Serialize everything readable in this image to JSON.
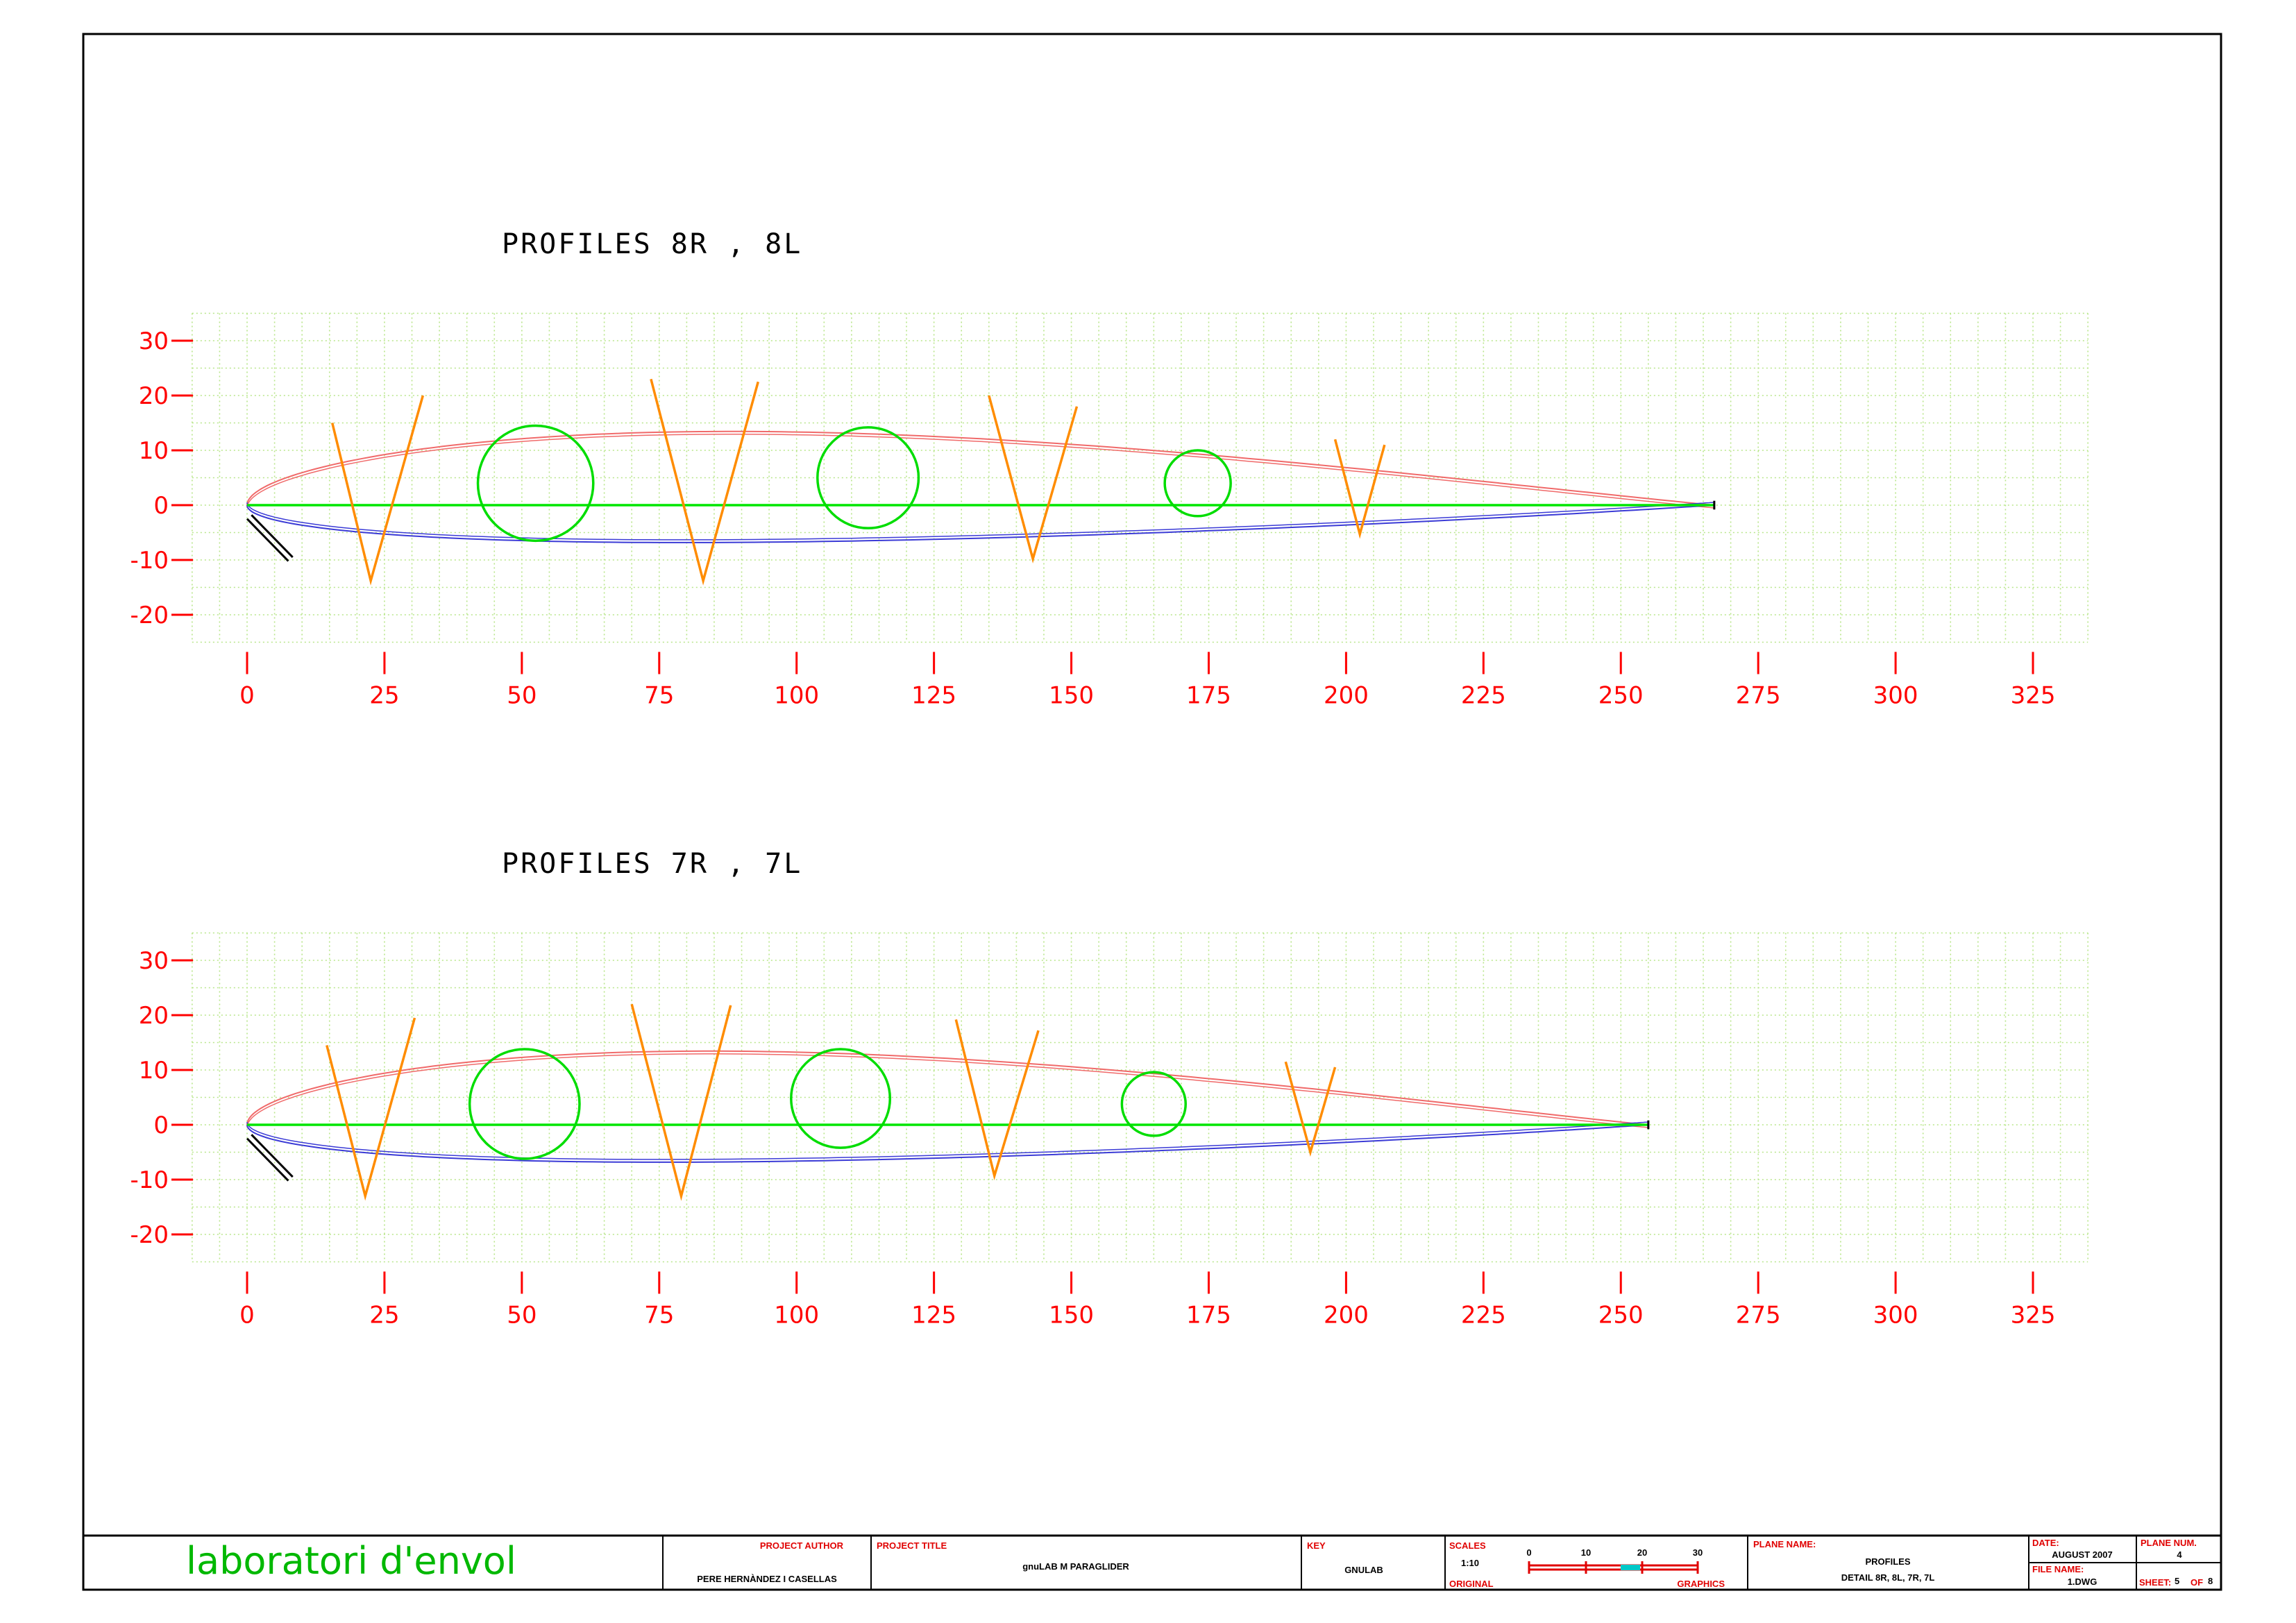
{
  "profiles": [
    {
      "title": "PROFILES 8R , 8L",
      "chord": 267,
      "circles": [
        {
          "x": 52.5,
          "y": 4,
          "r": 10.5
        },
        {
          "x": 113,
          "y": 5,
          "r": 9.2
        },
        {
          "x": 173,
          "y": 4,
          "r": 6
        }
      ],
      "diagonals": [
        {
          "x1": 15.5,
          "y1": 15,
          "x2": 22.5,
          "y2": -13.8,
          "x3": 32,
          "y3": 20
        },
        {
          "x1": 73.5,
          "y1": 23,
          "x2": 83,
          "y2": -13.8,
          "x3": 93,
          "y3": 22.5
        },
        {
          "x1": 135,
          "y1": 20,
          "x2": 143,
          "y2": -9.8,
          "x3": 151,
          "y3": 18
        },
        {
          "x1": 198,
          "y1": 12,
          "x2": 202.5,
          "y2": -5.3,
          "x3": 207,
          "y3": 11
        }
      ]
    },
    {
      "title": "PROFILES 7R , 7L",
      "chord": 255,
      "circles": [
        {
          "x": 50.5,
          "y": 3.8,
          "r": 10
        },
        {
          "x": 108,
          "y": 4.8,
          "r": 9
        },
        {
          "x": 165,
          "y": 3.8,
          "r": 5.8
        }
      ],
      "diagonals": [
        {
          "x1": 14.5,
          "y1": 14.5,
          "x2": 21.5,
          "y2": -13,
          "x3": 30.5,
          "y3": 19.5
        },
        {
          "x1": 70,
          "y1": 22,
          "x2": 79,
          "y2": -13,
          "x3": 88,
          "y3": 21.8
        },
        {
          "x1": 129,
          "y1": 19.2,
          "x2": 136,
          "y2": -9.3,
          "x3": 144,
          "y3": 17.2
        },
        {
          "x1": 189,
          "y1": 11.5,
          "x2": 193.5,
          "y2": -5,
          "x3": 198,
          "y3": 10.5
        }
      ]
    }
  ],
  "axes": {
    "x_ticks": [
      0,
      25,
      50,
      75,
      100,
      125,
      150,
      175,
      200,
      225,
      250,
      275,
      300,
      325
    ],
    "y_ticks": [
      30,
      20,
      10,
      0,
      -10,
      -20
    ],
    "x_range": [
      -10,
      335
    ],
    "y_range": [
      -25,
      35
    ],
    "grid_step": 5
  },
  "colors": {
    "grid": "#b8e68a",
    "axis_labels": "#ff0000",
    "upper_surface": "#f06a6a",
    "lower_surface": "#3b3bd6",
    "chord": "#00e600",
    "circles": "#00dd00",
    "diagonals": "#ff8c00",
    "frame": "#000000",
    "brand": "#00b800",
    "title_block_labels": "#e00000"
  },
  "title_block": {
    "brand": "laboratori d'envol",
    "author_label": "PROJECT AUTHOR",
    "author": "PERE HERNÀNDEZ I CASELLAS",
    "project_label": "PROJECT TITLE",
    "project": "gnuLAB M PARAGLIDER",
    "key_label": "KEY",
    "key": "GNULAB",
    "scales_label": "SCALES",
    "scale": "1:10",
    "scale_ticks": [
      "0",
      "10",
      "20",
      "30"
    ],
    "original_label": "ORIGINAL",
    "graphics_label": "GRAPHICS",
    "plane_label": "PLANE NAME:",
    "plane_name_1": "PROFILES",
    "plane_name_2": "DETAIL 8R, 8L, 7R, 7L",
    "date_label": "DATE:",
    "date": "AUGUST 2007",
    "file_label": "FILE NAME:",
    "file": "1.DWG",
    "planenum_label": "PLANE NUM.",
    "planenum": "4",
    "sheet_label": "SHEET:",
    "sheet_num": "5",
    "of_label": "OF",
    "sheet_total": "8"
  }
}
